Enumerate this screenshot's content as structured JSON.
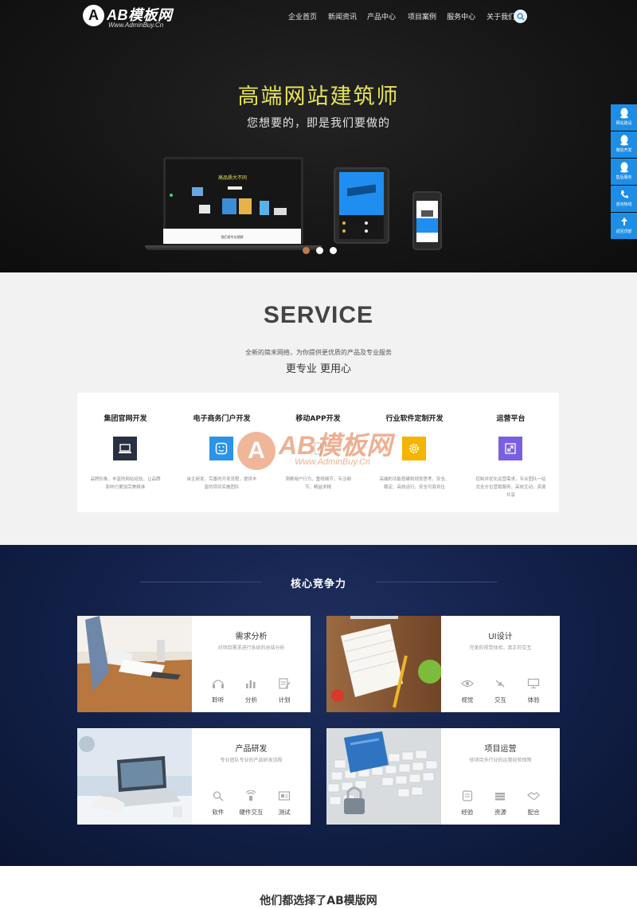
{
  "header": {
    "logo_badge": "A",
    "logo_text": "AB模板网",
    "logo_sub": "Www.AdminBuy.Cn",
    "nav": [
      "企业首页",
      "新闻资讯",
      "产品中心",
      "项目案例",
      "服务中心",
      "关于我们"
    ],
    "search_icon": "search-icon"
  },
  "hero": {
    "title": "高端网站建筑师",
    "subtitle": "您想要的，即是我们要做的",
    "slides": 3,
    "active_slide": 1,
    "laptop_screen_title": "高品质大不同",
    "laptop_footer_text": "我们用专业视野"
  },
  "side_float": [
    {
      "label": "网站建设",
      "icon": "qq-icon"
    },
    {
      "label": "微信开发",
      "icon": "qq-icon"
    },
    {
      "label": "售后服务",
      "icon": "qq-icon"
    },
    {
      "label": "咨询热线",
      "icon": "phone-icon"
    },
    {
      "label": "返回顶部",
      "icon": "arrow-up-icon"
    }
  ],
  "service": {
    "title": "SERVICE",
    "description": "全新的简末网络，为你提供更优质的产品及专业服务",
    "slogan": "更专业 更用心",
    "items": [
      {
        "title": "集团官网开发",
        "desc": "品牌形象，丰富的网站经验，让品牌影响力更加完美精准",
        "icon": "monitor-icon",
        "color": "#283142"
      },
      {
        "title": "电子商务门户开发",
        "desc": "自主研发，完善的开发流程，提供丰富的项目实施团队",
        "icon": "smile-icon",
        "color": "#2b93e8"
      },
      {
        "title": "移动APP开发",
        "desc": "洞察用户行为，重视细节，专注细节，精益求精",
        "icon": "phone-app-icon",
        "color": "#ffffff"
      },
      {
        "title": "行业软件定制开发",
        "desc": "高端的功能搭建和规划思考，安全、稳定、高效运行，安全可靠到位",
        "icon": "gear-icon",
        "color": "#f4b400"
      },
      {
        "title": "运营平台",
        "desc": "控制并优化运营需求，专业团队一站式全方位营销服务，高效互动，资源共享",
        "icon": "expand-icon",
        "color": "#7b5fe0"
      }
    ]
  },
  "watermark": {
    "badge": "A",
    "text": "AB模板网",
    "url": "Www.AdminBuy.Cn"
  },
  "core": {
    "title": "核心竞争力",
    "cards": [
      {
        "title": "需求分析",
        "desc": "对项目需求进行系统的总结分析",
        "feats": [
          {
            "label": "聆听",
            "icon": "headphones-icon"
          },
          {
            "label": "分析",
            "icon": "bar-chart-icon"
          },
          {
            "label": "计划",
            "icon": "plan-icon"
          }
        ]
      },
      {
        "title": "UI设计",
        "desc": "完美的视觉体验，真正的交互",
        "feats": [
          {
            "label": "视觉",
            "icon": "eye-icon"
          },
          {
            "label": "交互",
            "icon": "interact-icon"
          },
          {
            "label": "体验",
            "icon": "screen-icon"
          }
        ]
      },
      {
        "title": "产品研发",
        "desc": "专业团队专业的产品研发流程",
        "feats": [
          {
            "label": "软件",
            "icon": "magnifier-icon"
          },
          {
            "label": "硬件交互",
            "icon": "signal-icon"
          },
          {
            "label": "测试",
            "icon": "test-icon"
          }
        ]
      },
      {
        "title": "项目运营",
        "desc": "依项目多行业的运营经验保障",
        "feats": [
          {
            "label": "经验",
            "icon": "doc-icon"
          },
          {
            "label": "资源",
            "icon": "stack-icon"
          },
          {
            "label": "配合",
            "icon": "handshake-icon"
          }
        ]
      }
    ]
  },
  "clients": {
    "title": "他们都选择了AB模版网"
  }
}
